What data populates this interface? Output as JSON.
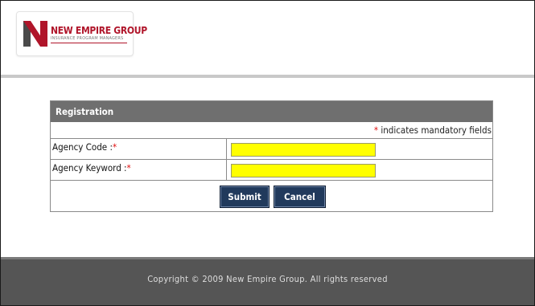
{
  "brand": {
    "name": "NEW EMPIRE GROUP",
    "tagline": "INSURANCE PROGRAM MANAGERS",
    "logo_letter": "N",
    "colors": {
      "primary": "#b0152a",
      "mark_dark": "#4a4a4a"
    }
  },
  "form": {
    "title": "Registration",
    "mandatory_marker": "*",
    "mandatory_note": " indicates mandatory fields",
    "fields": [
      {
        "label": "Agency Code :",
        "required_marker": "*",
        "value": "",
        "placeholder": ""
      },
      {
        "label": "Agency Keyword :",
        "required_marker": "*",
        "value": "",
        "placeholder": ""
      }
    ],
    "buttons": {
      "submit": "Submit",
      "cancel": "Cancel"
    },
    "colors": {
      "header_bg": "#6f6f6f",
      "input_bg": "#ffff00",
      "button_bg": "#213a5c",
      "required": "#e01010"
    }
  },
  "footer": {
    "copyright": "Copyright © 2009 New Empire Group. All rights reserved"
  }
}
